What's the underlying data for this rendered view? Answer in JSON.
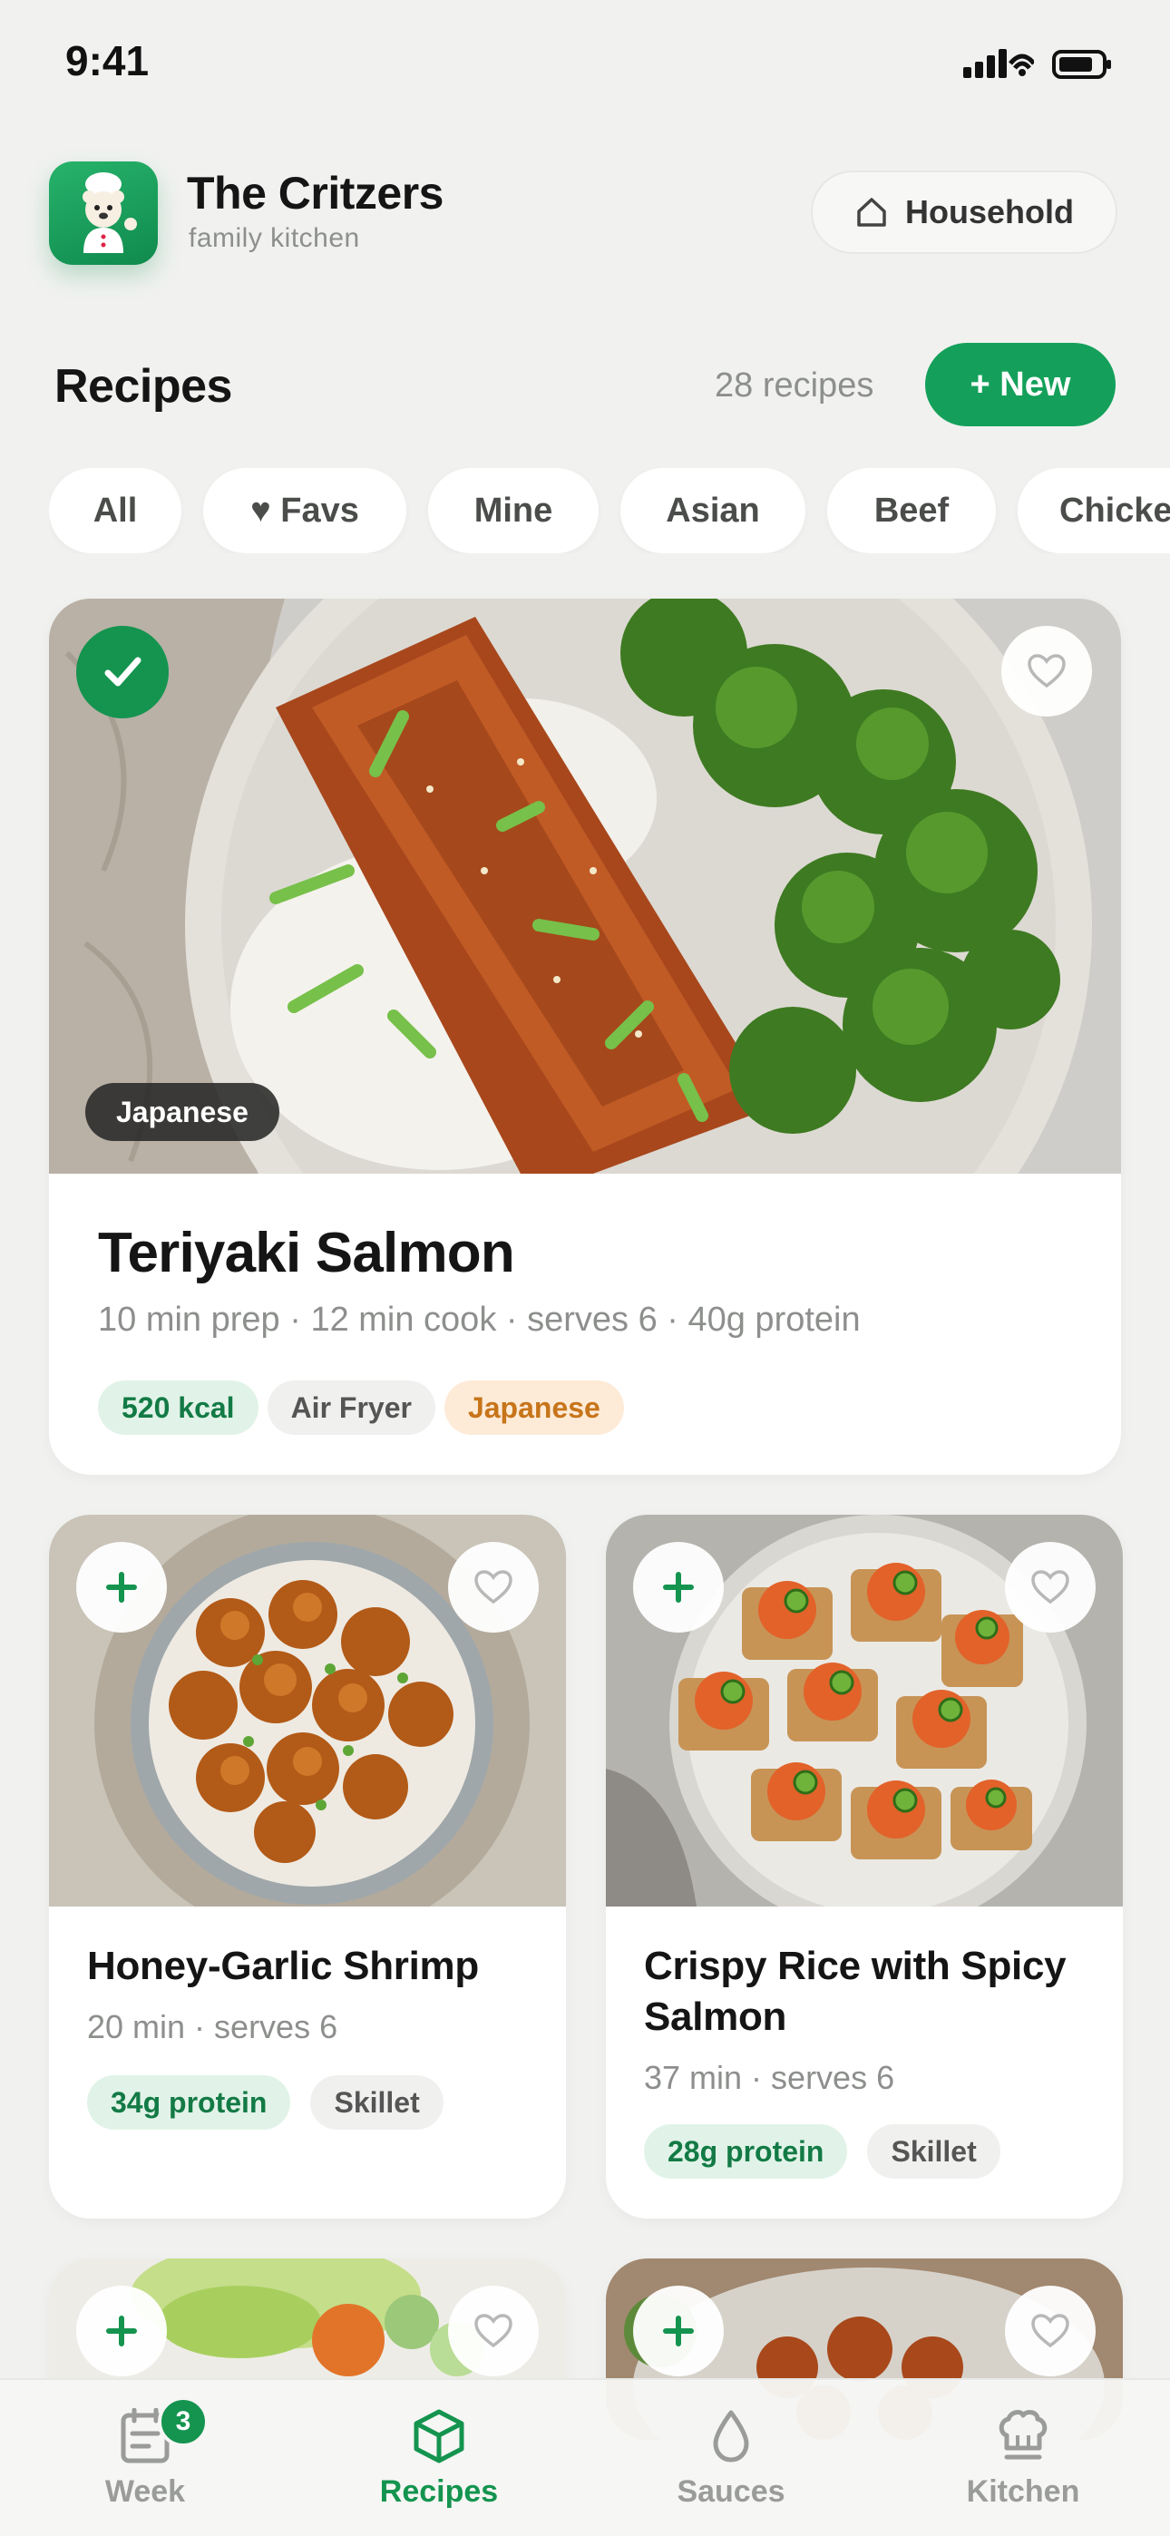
{
  "status_bar": {
    "time": "9:41"
  },
  "header": {
    "app_name": "The Critzers",
    "subtitle": "family kitchen",
    "household_label": "Household"
  },
  "section": {
    "title": "Recipes",
    "count": "28 recipes",
    "new_label": "+ New"
  },
  "filters": [
    "All",
    "♥ Favs",
    "Mine",
    "Asian",
    "Beef",
    "Chicken"
  ],
  "featured": {
    "title": "Teriyaki Salmon",
    "cuisine_tag": "Japanese",
    "meta": "10 min prep · 12 min cook · serves 6 · 40g protein",
    "tags": [
      "520 kcal",
      "Air Fryer",
      "Japanese"
    ],
    "selected": true
  },
  "recipes": [
    {
      "title": "Honey-Garlic Shrimp",
      "meta": "20 min · serves 6",
      "protein": "34g protein",
      "method": "Skillet"
    },
    {
      "title": "Crispy Rice with Spicy Salmon",
      "meta": "37 min · serves 6",
      "protein": "28g protein",
      "method": "Skillet"
    }
  ],
  "bottom_nav": {
    "items": [
      "Week",
      "Recipes",
      "Sauces",
      "Kitchen"
    ],
    "active": "Recipes",
    "week_badge": "3"
  },
  "colors": {
    "accent": "#14944f",
    "background": "#f1f2f0",
    "chip_bg": "#ffffff",
    "tag_green_bg": "#e1f3e8",
    "tag_orange_bg": "#fdebd8"
  }
}
